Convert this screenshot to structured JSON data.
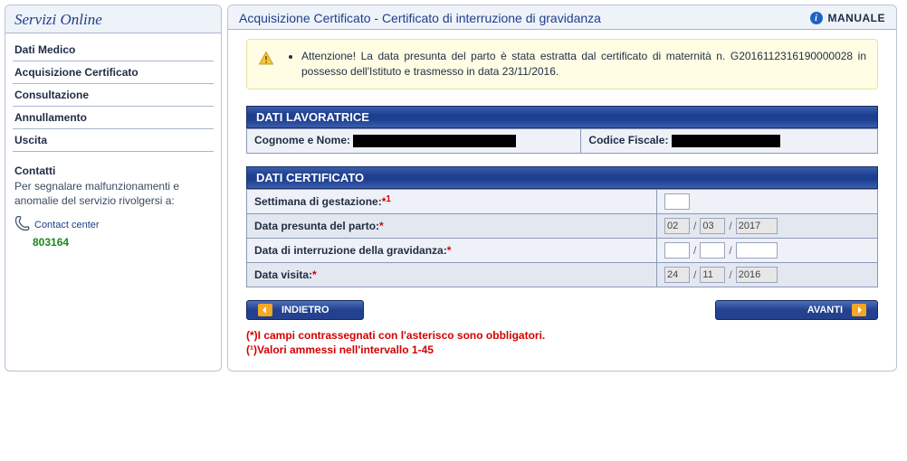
{
  "sidebar": {
    "title": "Servizi Online",
    "items": [
      {
        "label": "Dati Medico"
      },
      {
        "label": "Acquisizione Certificato"
      },
      {
        "label": "Consultazione"
      },
      {
        "label": "Annullamento"
      },
      {
        "label": "Uscita"
      }
    ],
    "contacts": {
      "title": "Contatti",
      "text": "Per segnalare malfunzionamenti e anomalie del servizio rivolgersi a:",
      "label": "Contact center",
      "number": "803164"
    }
  },
  "main": {
    "title": "Acquisizione Certificato - Certificato di interruzione di gravidanza",
    "manual": "MANUALE",
    "alert": "Attenzione! La data presunta del parto è stata estratta dal certificato di maternità n. G2016112316190000028 in possesso dell'Istituto e trasmesso in data 23/11/2016.",
    "section_lavoratrice": {
      "header": "DATI LAVORATRICE",
      "cognome_label": "Cognome e Nome:",
      "cognome_value": "",
      "codice_label": "Codice Fiscale:",
      "codice_value": ""
    },
    "section_certificato": {
      "header": "DATI CERTIFICATO",
      "rows": {
        "settimana": {
          "label": "Settimana di gestazione:",
          "value": ""
        },
        "data_parto": {
          "label": "Data presunta del parto:",
          "day": "02",
          "month": "03",
          "year": "2017"
        },
        "data_interruzione": {
          "label": "Data di interruzione della gravidanza:",
          "day": "",
          "month": "",
          "year": ""
        },
        "data_visita": {
          "label": "Data visita:",
          "day": "24",
          "month": "11",
          "year": "2016"
        }
      }
    },
    "buttons": {
      "back": "INDIETRO",
      "next": "AVANTI"
    },
    "footnotes": {
      "l1": "(*)I campi contrassegnati con l'asterisco sono obbligatori.",
      "l2": "(¹)Valori ammessi nell'intervallo 1-45"
    }
  }
}
